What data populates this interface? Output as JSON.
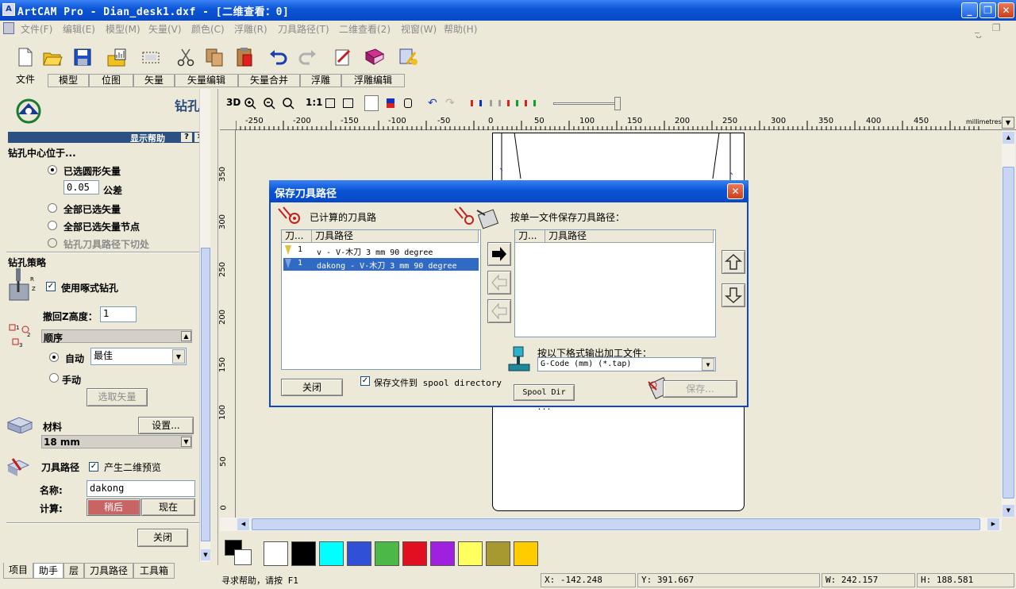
{
  "window": {
    "title": "ArtCAM Pro - Dian_desk1.dxf - [二维查看：0]",
    "min": "_",
    "max": "❐",
    "close": "✕"
  },
  "menu": [
    "文件(F)",
    "编辑(E)",
    "模型(M)",
    "矢量(V)",
    "颜色(C)",
    "浮雕(R)",
    "刀具路径(T)",
    "二维查看(2)",
    "视窗(W)",
    "帮助(H)"
  ],
  "toolbar_tabs": [
    "文件",
    "模型",
    "位图",
    "矢量",
    "矢量编辑",
    "矢量合并",
    "浮雕",
    "浮雕编辑"
  ],
  "left": {
    "title": "钻孔",
    "help_label": "显示帮助",
    "help_q": "?",
    "help_x": "✕",
    "center_header": "钻孔中心位于...",
    "opt_selected_circles": "已选圆形矢量",
    "tolerance_value": "0.05",
    "tolerance_label": "公差",
    "opt_all_selected": "全部已选矢量",
    "opt_all_nodes": "全部已选矢量节点",
    "opt_cut_points": "钻孔刀具路径下切处",
    "strategy_header": "钻孔策略",
    "peck_label": "使用啄式钻孔",
    "retract_label": "撤回Z高度：",
    "retract_value": "1",
    "order_header": "顺序",
    "auto_label": "自动",
    "auto_value": "最佳",
    "manual_label": "手动",
    "select_vectors_btn": "选取矢量",
    "material_label": "材料",
    "setup_btn": "设置...",
    "thickness": "18 mm",
    "toolpath_label": "刀具路径",
    "preview_label": "产生二维预览",
    "name_label": "名称:",
    "name_value": "dakong",
    "calc_label": "计算:",
    "later_btn": "稍后",
    "now_btn": "现在",
    "close_btn": "关闭"
  },
  "bottom_tabs": [
    "项目",
    "助手",
    "层",
    "刀具路径",
    "工具箱"
  ],
  "view_tools": {
    "label_3d": "3D",
    "label_11": "1:1"
  },
  "ruler": {
    "x_labels": [
      "-250",
      "-200",
      "-150",
      "-100",
      "-50",
      "0",
      "50",
      "100",
      "150",
      "200",
      "250",
      "300",
      "350",
      "400",
      "450"
    ],
    "unit": "millimetres",
    "y_labels": [
      "350",
      "300",
      "250",
      "200",
      "150",
      "100",
      "50",
      "0"
    ]
  },
  "dialog": {
    "title": "保存刀具路径",
    "close": "✕",
    "calc_label": "已计算的刀具路",
    "single_file_label": "按单一文件保存刀具路径：",
    "col_tool": "刀...",
    "col_path": "刀具路径",
    "left_items": [
      {
        "num": "1",
        "text": "v - V-木刀 3 mm 90 degree"
      },
      {
        "num": "1",
        "text": "dakong - V-木刀 3 mm 90 degree"
      }
    ],
    "right_col_tool": "刀...",
    "right_col_path": "刀具路径",
    "format_label": "按以下格式输出加工文件：",
    "format_value": "G-Code (mm) (*.tap)",
    "close_btn": "关闭",
    "spool_check": "保存文件到 spool directory",
    "spool_btn": "Spool Dir ...",
    "save_btn": "保存..."
  },
  "palette": [
    "#ffffff",
    "#000000",
    "#00ffff",
    "#3050d8",
    "#4cb848",
    "#e01020",
    "#a020e0",
    "#ffff60",
    "#a89830",
    "#ffcc00"
  ],
  "status": {
    "help": "寻求帮助，请按 F1",
    "x": "X: -142.248",
    "y": "Y: 391.667",
    "w": "W: 242.157",
    "h": "H: 188.581"
  }
}
